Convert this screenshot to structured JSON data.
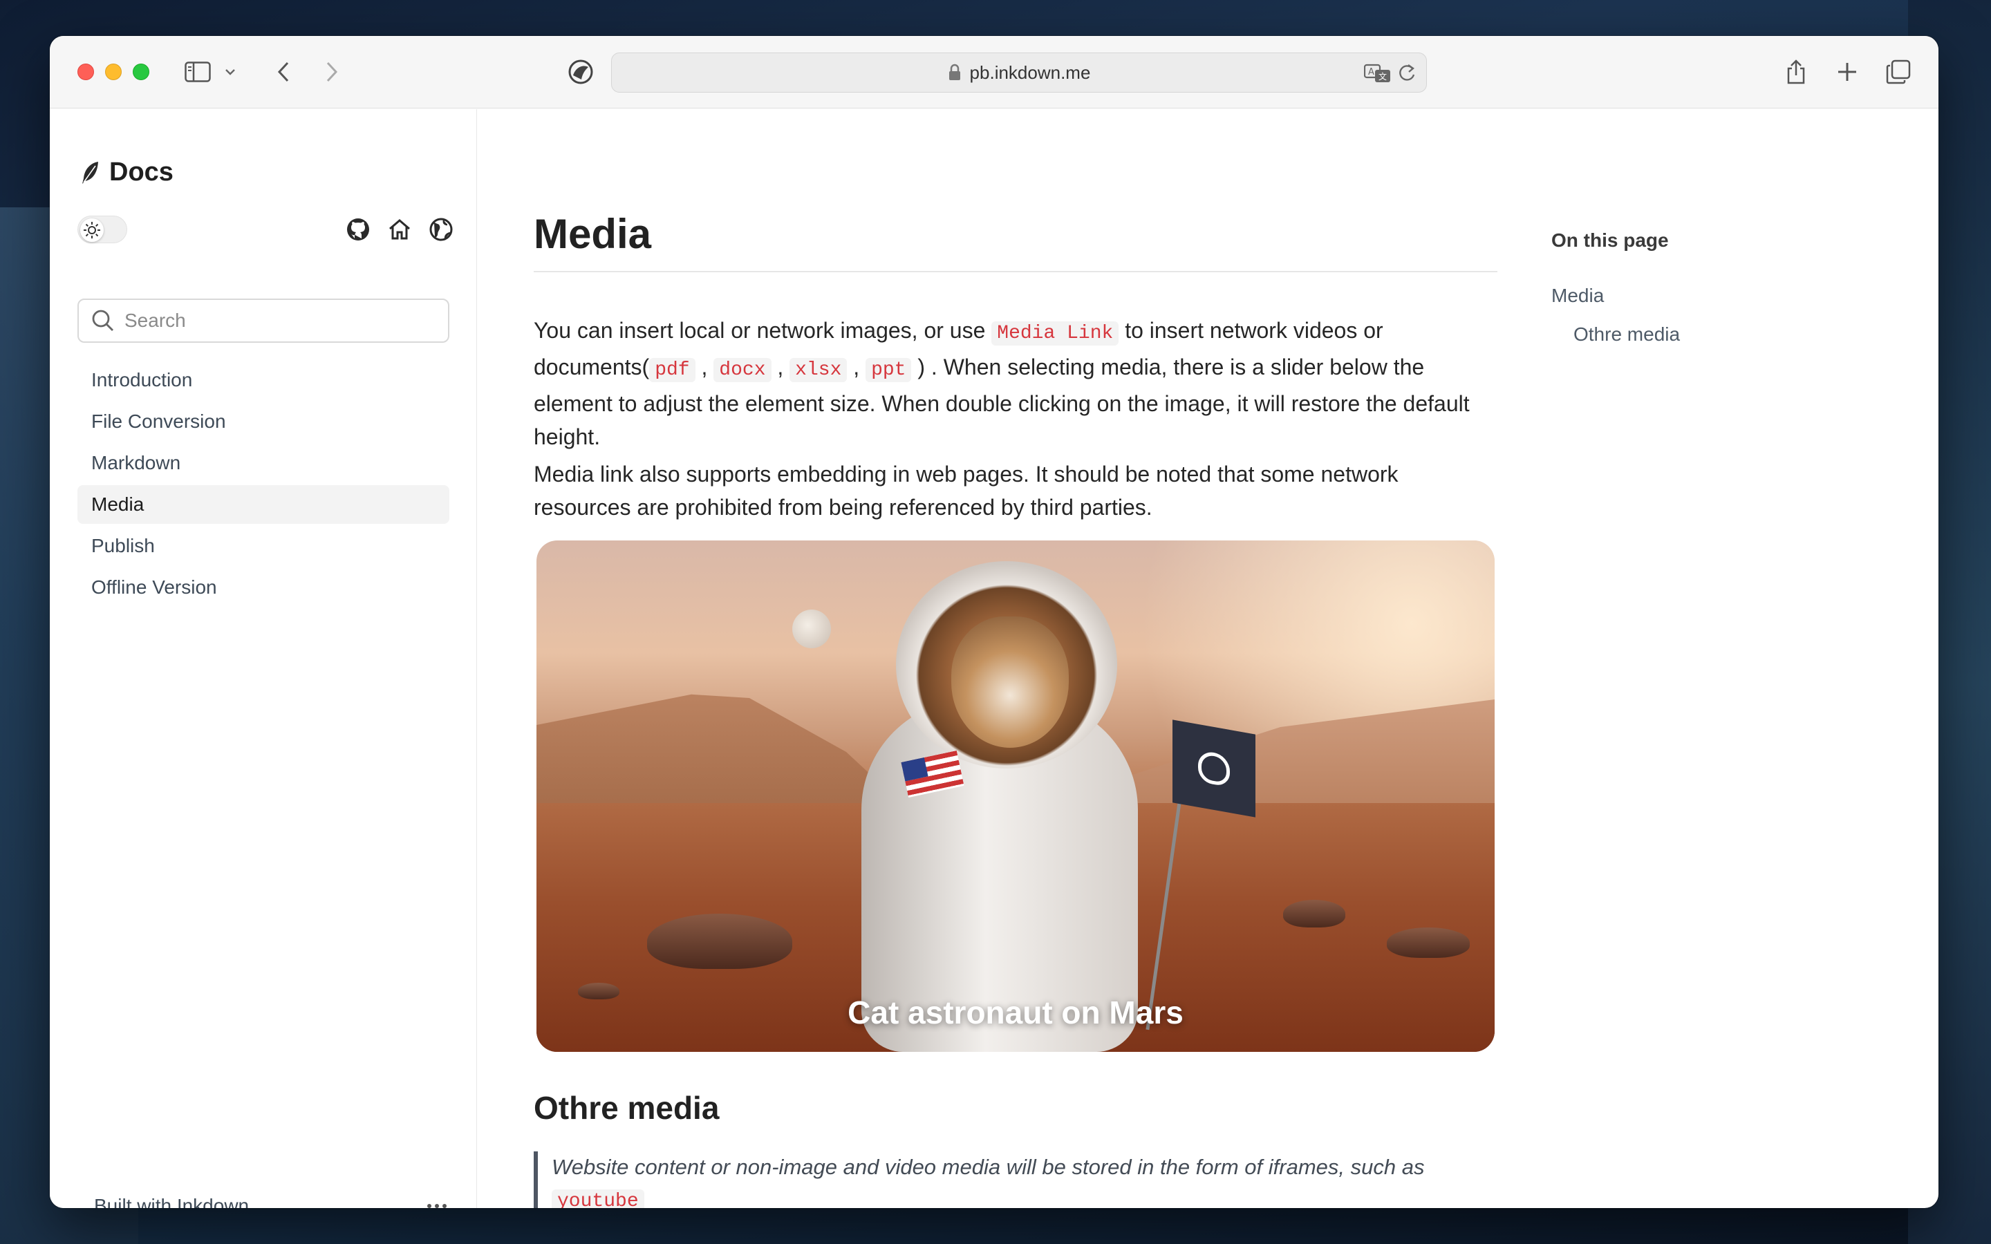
{
  "browser": {
    "url": "pb.inkdown.me"
  },
  "sidebar": {
    "brand": "Docs",
    "search_placeholder": "Search",
    "items": [
      {
        "label": "Introduction"
      },
      {
        "label": "File Conversion"
      },
      {
        "label": "Markdown"
      },
      {
        "label": "Media"
      },
      {
        "label": "Publish"
      },
      {
        "label": "Offline Version"
      }
    ],
    "active_item": "Media",
    "footer": "Built with Inkdown"
  },
  "content": {
    "title": "Media",
    "p1": {
      "t1": "You can insert local or network images, or use ",
      "code_media_link": "Media Link",
      "t2": " to insert network videos or documents(",
      "code_pdf": "pdf",
      "sep1": " , ",
      "code_docx": "docx",
      "sep2": " , ",
      "code_xlsx": "xlsx",
      "sep3": " , ",
      "code_ppt": "ppt",
      "t3": " ) . When selecting media, there is a slider below the element to adjust the element size. When double clicking on the image, it will restore the default height."
    },
    "p2": "Media link also supports embedding in web pages. It should be noted that some network resources are prohibited from being referenced by third parties.",
    "image_caption": "Cat astronaut on Mars",
    "h2": "Othre media",
    "quote_text": "Website content or non-image and video media will be stored in the form of iframes, such as ",
    "quote_code": "youtube"
  },
  "toc": {
    "title": "On this page",
    "items": [
      {
        "label": "Media"
      },
      {
        "label": "Othre media"
      }
    ]
  },
  "icons": {
    "sidebar_toggle": "sidebar-icon",
    "back": "chevron-left-icon",
    "forward": "chevron-right-icon",
    "privacy": "privacy-shield-icon",
    "lock": "lock-icon",
    "translate": "translate-icon",
    "reload": "reload-icon",
    "share": "share-icon",
    "new_tab": "plus-icon",
    "tabs": "tabs-overview-icon",
    "github": "github-icon",
    "home": "home-icon",
    "globe": "globe-icon",
    "theme": "sun-icon",
    "search": "search-icon",
    "more": "more-icon",
    "logo": "feather-icon"
  },
  "colors": {
    "code_text": "#d6363d",
    "active_nav_bg": "#f3f3f3"
  }
}
